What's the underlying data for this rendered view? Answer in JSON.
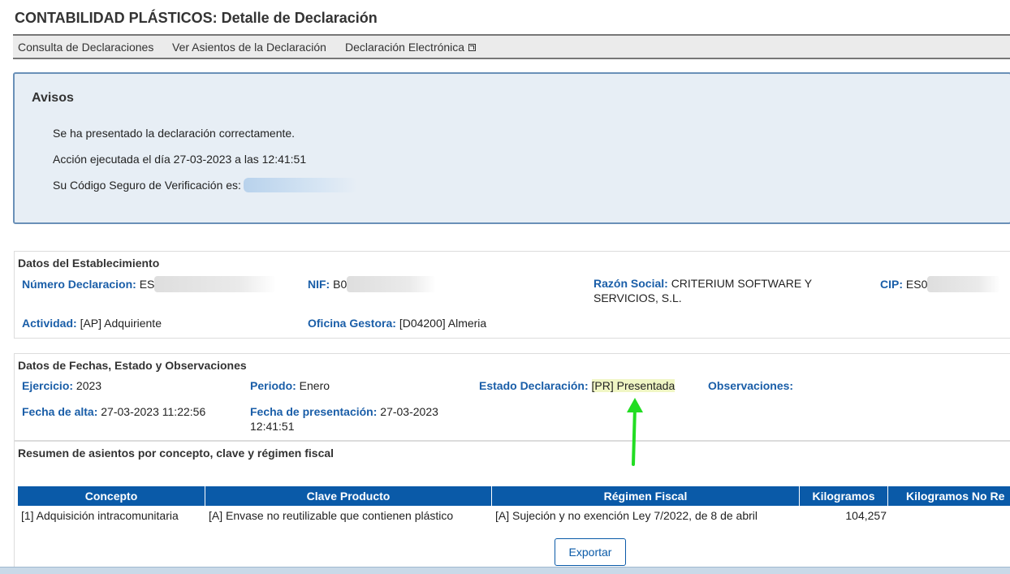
{
  "header": {
    "title": "CONTABILIDAD PLÁSTICOS: Detalle de Declaración"
  },
  "nav": {
    "items": [
      {
        "label": "Consulta de Declaraciones"
      },
      {
        "label": "Ver Asientos de la Declaración"
      },
      {
        "label": "Declaración Electrónica"
      }
    ]
  },
  "avisos": {
    "title": "Avisos",
    "line1": "Se ha presentado la declaración correctamente.",
    "line2": "Acción ejecutada el día 27-03-2023 a las 12:41:51",
    "line3": "Su Código Seguro de Verificación es:"
  },
  "establecimiento": {
    "title": "Datos del Establecimiento",
    "numero_label": "Número Declaracion:",
    "numero_value": "ES",
    "nif_label": "NIF:",
    "nif_value": "B0",
    "razon_label": "Razón Social:",
    "razon_value": "CRITERIUM SOFTWARE Y SERVICIOS, S.L.",
    "cip_label": "CIP:",
    "cip_value": "ES0",
    "actividad_label": "Actividad:",
    "actividad_value": "[AP] Adquiriente",
    "oficina_label": "Oficina Gestora:",
    "oficina_value": "[D04200] Almeria"
  },
  "fechas": {
    "title": "Datos de Fechas, Estado y Observaciones",
    "ejercicio_label": "Ejercicio:",
    "ejercicio_value": "2023",
    "periodo_label": "Periodo:",
    "periodo_value": "Enero",
    "estado_label": "Estado Declaración:",
    "estado_value": "[PR] Presentada",
    "observaciones_label": "Observaciones:",
    "alta_label": "Fecha de alta:",
    "alta_value": "27-03-2023 11:22:56",
    "presentacion_label": "Fecha de presentación:",
    "presentacion_value": "27-03-2023 12:41:51"
  },
  "resumen": {
    "title": "Resumen de asientos por concepto, clave y régimen fiscal",
    "columns": [
      "Concepto",
      "Clave Producto",
      "Régimen Fiscal",
      "Kilogramos",
      "Kilogramos No Re"
    ],
    "row": {
      "concepto": "[1] Adquisición intracomunitaria",
      "clave": "[A] Envase no reutilizable que contienen plástico",
      "regimen": "[A] Sujeción y no exención Ley 7/2022, de 8 de abril",
      "kilogramos": "104,257"
    }
  },
  "actions": {
    "export_label": "Exportar"
  },
  "colors": {
    "accent": "#0a5aa8",
    "label": "#1a5ea8",
    "notice_bg": "#e7eef5",
    "arrow": "#22dd22"
  }
}
